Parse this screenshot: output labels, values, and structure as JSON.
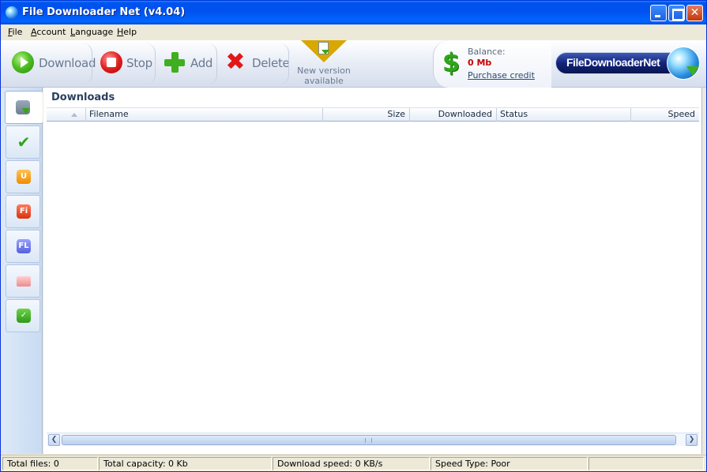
{
  "window": {
    "title": "File Downloader Net (v4.04)",
    "icons": {
      "app": "globe-icon",
      "minimize": "minimize-icon",
      "maximize": "maximize-icon",
      "close": "close-icon"
    },
    "close_glyph": "✕"
  },
  "menu": {
    "items": [
      {
        "label": "File",
        "hotkey": "F",
        "rest": "ile"
      },
      {
        "label": "Account",
        "hotkey": "A",
        "rest": "ccount"
      },
      {
        "label": "Language",
        "hotkey": "L",
        "rest": "anguage"
      },
      {
        "label": "Help",
        "hotkey": "H",
        "rest": "elp"
      }
    ]
  },
  "toolbar": {
    "download_label": "Download",
    "stop_label": "Stop",
    "add_label": "Add",
    "delete_label": "Delete",
    "delete_glyph": "✖",
    "new_version_line1": "New version",
    "new_version_line2": "available",
    "balance_label": "Balance:",
    "balance_value": "0 Mb",
    "purchase_credit": "Purchase credit",
    "dollar_glyph": "$",
    "logo_text_a": "FileDownloader",
    "logo_text_b": "Net"
  },
  "sidebar": {
    "items": [
      {
        "name": "downloads",
        "icon": "downloads-icon",
        "glyph": ""
      },
      {
        "name": "completed",
        "icon": "checkmark-icon",
        "glyph": "✔"
      },
      {
        "name": "u-service",
        "icon": "u-service-icon",
        "glyph": "U"
      },
      {
        "name": "fi-service",
        "icon": "fi-service-icon",
        "glyph": "Fi"
      },
      {
        "name": "fl-service",
        "icon": "fl-service-icon",
        "glyph": "FL"
      },
      {
        "name": "mail",
        "icon": "mail-icon",
        "glyph": ""
      },
      {
        "name": "check",
        "icon": "check-box-icon",
        "glyph": "✓"
      }
    ]
  },
  "main": {
    "title": "Downloads",
    "columns": [
      {
        "label": "Filename"
      },
      {
        "label": "Size"
      },
      {
        "label": "Downloaded"
      },
      {
        "label": "Status"
      },
      {
        "label": "Speed"
      }
    ],
    "rows": []
  },
  "scrollbar": {
    "left_glyph": "❮",
    "right_glyph": "❯"
  },
  "status": {
    "total_files": "Total files: 0",
    "total_capacity": "Total capacity: 0 Kb",
    "download_speed": "Download speed: 0 KB/s",
    "speed_type": "Speed Type: Poor",
    "extra": ""
  }
}
